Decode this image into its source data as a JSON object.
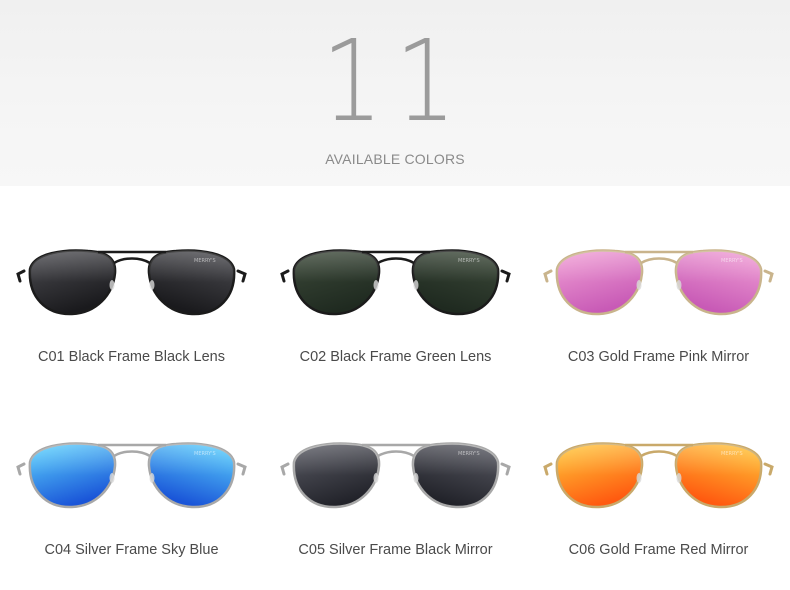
{
  "header": {
    "count": "11",
    "subtitle": "AVAILABLE COLORS"
  },
  "brand_mark": "MERRY'S",
  "variants": [
    {
      "label": "C01 Black Frame Black Lens",
      "frame_color": "#1b1b1b",
      "lens_top": "#4e4e53",
      "lens_bottom": "#1a1a1d",
      "temple_tip": "#111111"
    },
    {
      "label": "C02 Black Frame Green Lens",
      "frame_color": "#1b1b1b",
      "lens_top": "#3d4a3a",
      "lens_bottom": "#1f2a20",
      "temple_tip": "#111111"
    },
    {
      "label": "C03 Gold Frame Pink Mirror",
      "frame_color": "#c9b48c",
      "lens_top": "#f2a2d6",
      "lens_bottom": "#c85ab6",
      "temple_tip": "#d7c5b5"
    },
    {
      "label": "C04 Silver Frame Sky Blue",
      "frame_color": "#a8a8a8",
      "lens_top": "#5fd8ff",
      "lens_bottom": "#1a55d8",
      "temple_tip": "#2a2a2a"
    },
    {
      "label": "C05 Silver Frame Black Mirror",
      "frame_color": "#a8a8a8",
      "lens_top": "#5c5d66",
      "lens_bottom": "#22232a",
      "temple_tip": "#2a2a2a"
    },
    {
      "label": "C06 Gold Frame Red Mirror",
      "frame_color": "#c9a96a",
      "lens_top": "#ffcc3a",
      "lens_bottom": "#ff5a10",
      "temple_tip": "#e0b89a"
    }
  ]
}
